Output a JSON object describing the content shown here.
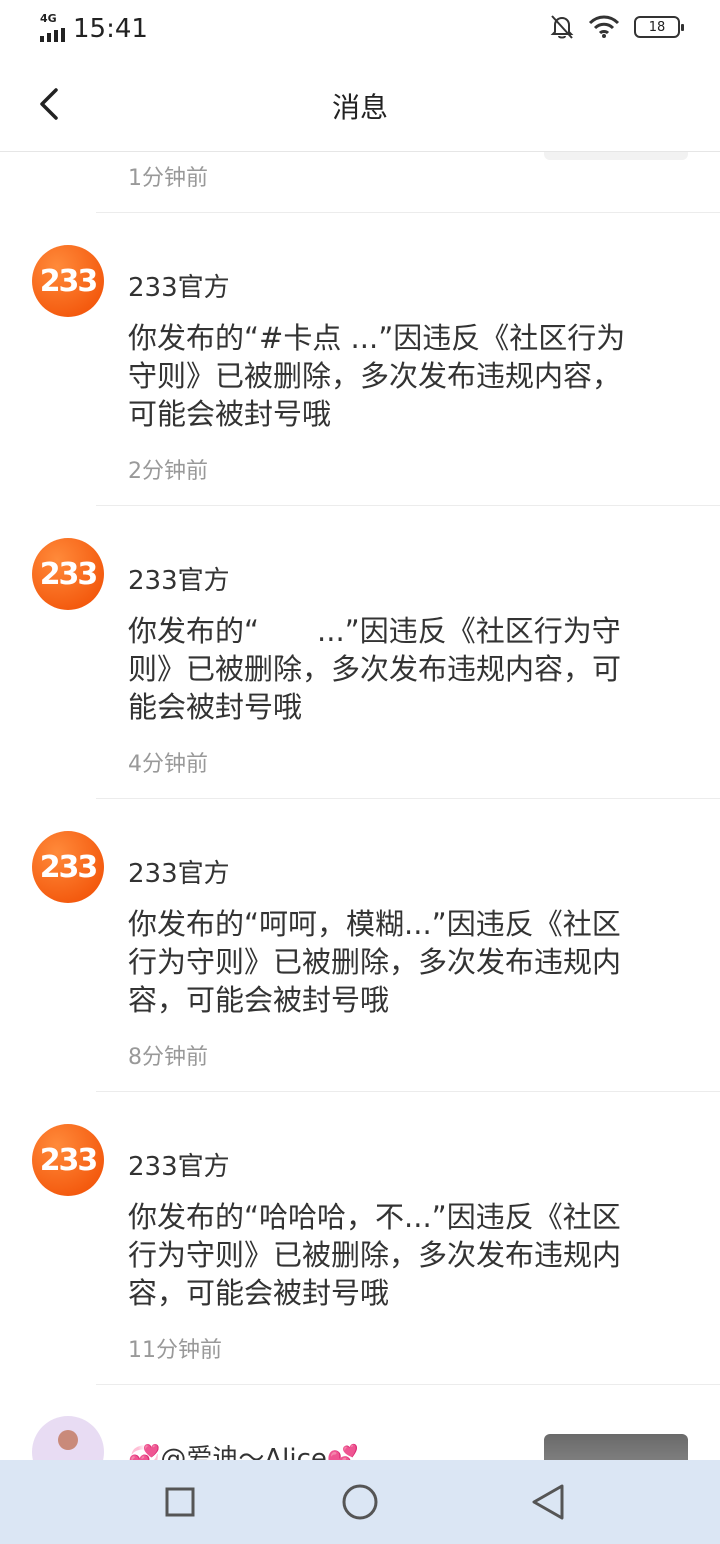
{
  "status_bar": {
    "network": "4G",
    "time": "15:41",
    "battery": "18",
    "icons": [
      "mute-bell-icon",
      "wifi-icon",
      "battery-icon"
    ]
  },
  "header": {
    "title": "消息",
    "back_icon": "back-arrow-icon"
  },
  "partial_item": {
    "time": "1分钟前"
  },
  "messages": [
    {
      "avatar_text": "233",
      "sender": "233官方",
      "text": "你发布的“#卡点 ...”因违反《社区行为守则》已被删除，多次发布违规内容，可能会被封号哦",
      "time": "2分钟前"
    },
    {
      "avatar_text": "233",
      "sender": "233官方",
      "text": "你发布的“　　...”因违反《社区行为守则》已被删除，多次发布违规内容，可能会被封号哦",
      "time": "4分钟前"
    },
    {
      "avatar_text": "233",
      "sender": "233官方",
      "text": "你发布的“呵呵，模糊...”因违反《社区行为守则》已被删除，多次发布违规内容，可能会被封号哦",
      "time": "8分钟前"
    },
    {
      "avatar_text": "233",
      "sender": "233官方",
      "text": "你发布的“哈哈哈，不...”因违反《社区行为守则》已被删除，多次发布违规内容，可能会被封号哦",
      "time": "11分钟前"
    }
  ],
  "last_item": {
    "sender": "💞@爱迪～Alice💕"
  },
  "nav_bar": {
    "icons": [
      "recent-apps-icon",
      "home-icon",
      "back-triangle-icon"
    ]
  },
  "colors": {
    "brand_orange": "#f04a00",
    "nav_bg": "#dbe6f4",
    "time_gray": "#999999"
  }
}
